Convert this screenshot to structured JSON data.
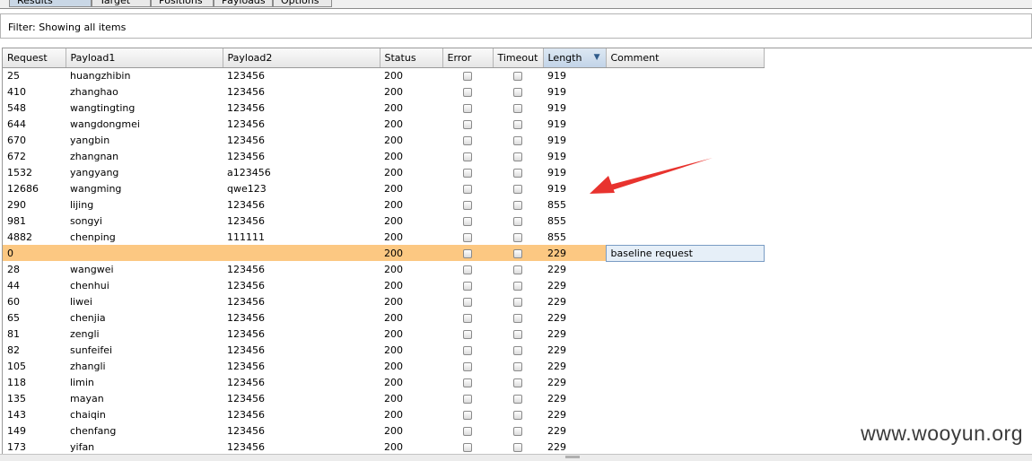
{
  "tabs": [
    {
      "label": "Results",
      "active": true
    },
    {
      "label": "Target",
      "active": false
    },
    {
      "label": "Positions",
      "active": false
    },
    {
      "label": "Payloads",
      "active": false
    },
    {
      "label": "Options",
      "active": false
    }
  ],
  "filter": {
    "label": "Filter: Showing all items"
  },
  "table": {
    "columns": [
      "Request",
      "Payload1",
      "Payload2",
      "Status",
      "Error",
      "Timeout",
      "Length",
      "Comment"
    ],
    "sorted_column": "Length",
    "sort_direction": "descending",
    "rows": [
      {
        "request": "25",
        "payload1": "huangzhibin",
        "payload2": "123456",
        "status": "200",
        "length": "919",
        "comment": ""
      },
      {
        "request": "410",
        "payload1": "zhanghao",
        "payload2": "123456",
        "status": "200",
        "length": "919",
        "comment": ""
      },
      {
        "request": "548",
        "payload1": "wangtingting",
        "payload2": "123456",
        "status": "200",
        "length": "919",
        "comment": ""
      },
      {
        "request": "644",
        "payload1": "wangdongmei",
        "payload2": "123456",
        "status": "200",
        "length": "919",
        "comment": ""
      },
      {
        "request": "670",
        "payload1": "yangbin",
        "payload2": "123456",
        "status": "200",
        "length": "919",
        "comment": ""
      },
      {
        "request": "672",
        "payload1": "zhangnan",
        "payload2": "123456",
        "status": "200",
        "length": "919",
        "comment": ""
      },
      {
        "request": "1532",
        "payload1": "yangyang",
        "payload2": "a123456",
        "status": "200",
        "length": "919",
        "comment": ""
      },
      {
        "request": "12686",
        "payload1": "wangming",
        "payload2": "qwe123",
        "status": "200",
        "length": "919",
        "comment": ""
      },
      {
        "request": "290",
        "payload1": "lijing",
        "payload2": "123456",
        "status": "200",
        "length": "855",
        "comment": ""
      },
      {
        "request": "981",
        "payload1": "songyi",
        "payload2": "123456",
        "status": "200",
        "length": "855",
        "comment": ""
      },
      {
        "request": "4882",
        "payload1": "chenping",
        "payload2": "111111",
        "status": "200",
        "length": "855",
        "comment": ""
      },
      {
        "request": "0",
        "payload1": "",
        "payload2": "",
        "status": "200",
        "length": "229",
        "comment": "baseline request",
        "selected": true
      },
      {
        "request": "28",
        "payload1": "wangwei",
        "payload2": "123456",
        "status": "200",
        "length": "229",
        "comment": ""
      },
      {
        "request": "44",
        "payload1": "chenhui",
        "payload2": "123456",
        "status": "200",
        "length": "229",
        "comment": ""
      },
      {
        "request": "60",
        "payload1": "liwei",
        "payload2": "123456",
        "status": "200",
        "length": "229",
        "comment": ""
      },
      {
        "request": "65",
        "payload1": "chenjia",
        "payload2": "123456",
        "status": "200",
        "length": "229",
        "comment": ""
      },
      {
        "request": "81",
        "payload1": "zengli",
        "payload2": "123456",
        "status": "200",
        "length": "229",
        "comment": ""
      },
      {
        "request": "82",
        "payload1": "sunfeifei",
        "payload2": "123456",
        "status": "200",
        "length": "229",
        "comment": ""
      },
      {
        "request": "105",
        "payload1": "zhangli",
        "payload2": "123456",
        "status": "200",
        "length": "229",
        "comment": ""
      },
      {
        "request": "118",
        "payload1": "limin",
        "payload2": "123456",
        "status": "200",
        "length": "229",
        "comment": ""
      },
      {
        "request": "135",
        "payload1": "mayan",
        "payload2": "123456",
        "status": "200",
        "length": "229",
        "comment": ""
      },
      {
        "request": "143",
        "payload1": "chaiqin",
        "payload2": "123456",
        "status": "200",
        "length": "229",
        "comment": ""
      },
      {
        "request": "149",
        "payload1": "chenfang",
        "payload2": "123456",
        "status": "200",
        "length": "229",
        "comment": ""
      },
      {
        "request": "173",
        "payload1": "yifan",
        "payload2": "123456",
        "status": "200",
        "length": "229",
        "comment": ""
      }
    ]
  },
  "annotation": {
    "arrow_color": "#e8332e"
  },
  "watermark": "www.wooyun.org",
  "colors": {
    "selected_row": "#fcc882",
    "sorted_header": "#c2d4e8"
  }
}
